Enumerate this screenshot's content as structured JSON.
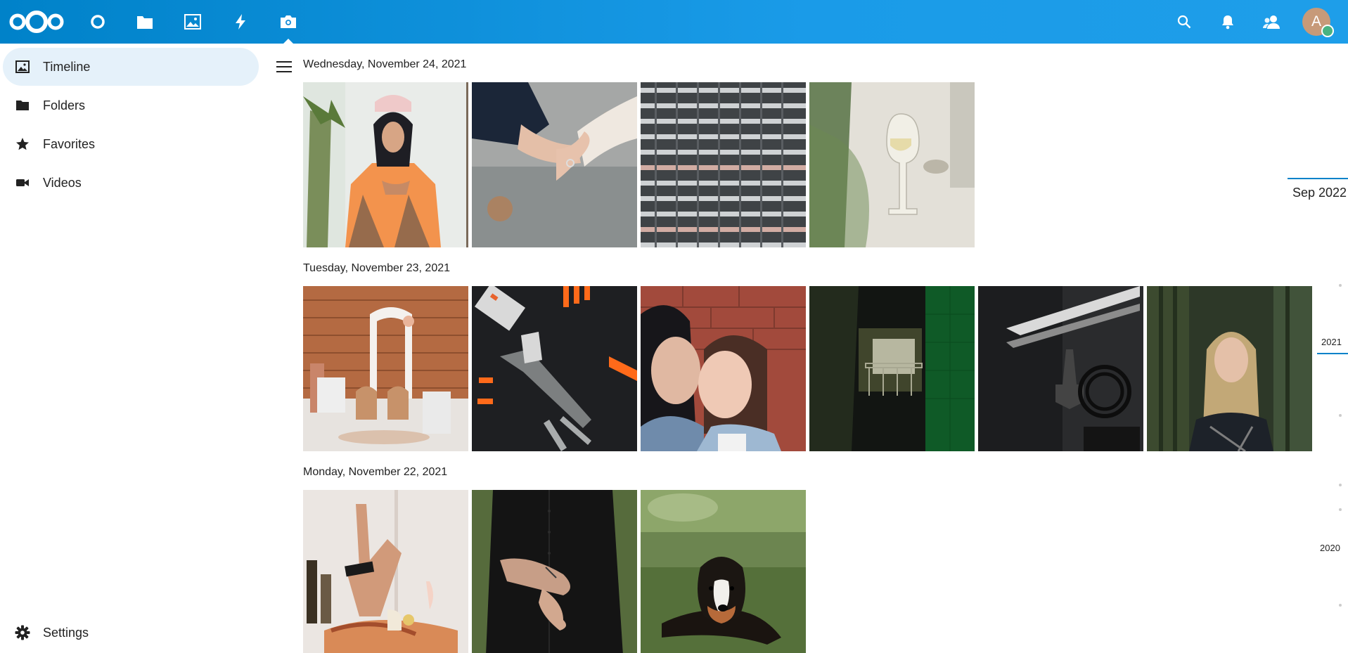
{
  "header": {
    "apps": [
      {
        "name": "dashboard",
        "icon": "circle-icon"
      },
      {
        "name": "files",
        "icon": "folder-icon"
      },
      {
        "name": "photos",
        "icon": "image-icon"
      },
      {
        "name": "activity",
        "icon": "lightning-icon"
      },
      {
        "name": "memories",
        "icon": "camera-icon",
        "active": true
      }
    ],
    "avatar_initial": "A"
  },
  "sidebar": {
    "items": [
      {
        "label": "Timeline",
        "icon": "image-icon",
        "active": true
      },
      {
        "label": "Folders",
        "icon": "folder-icon"
      },
      {
        "label": "Favorites",
        "icon": "star-icon"
      },
      {
        "label": "Videos",
        "icon": "video-icon"
      }
    ],
    "settings_label": "Settings"
  },
  "timeline": {
    "days": [
      {
        "label": "Wednesday, November 24, 2021",
        "photo_count": 4
      },
      {
        "label": "Tuesday, November 23, 2021",
        "photo_count": 6
      },
      {
        "label": "Monday, November 22, 2021",
        "photo_count": 3
      }
    ]
  },
  "scrubber": {
    "current": "Sep 2022",
    "years": [
      "2021",
      "2020"
    ]
  },
  "colors": {
    "header_start": "#0082c9",
    "header_end": "#1e9ee9",
    "active_nav_bg": "#e5f1fa",
    "accent": "#0082c9"
  }
}
